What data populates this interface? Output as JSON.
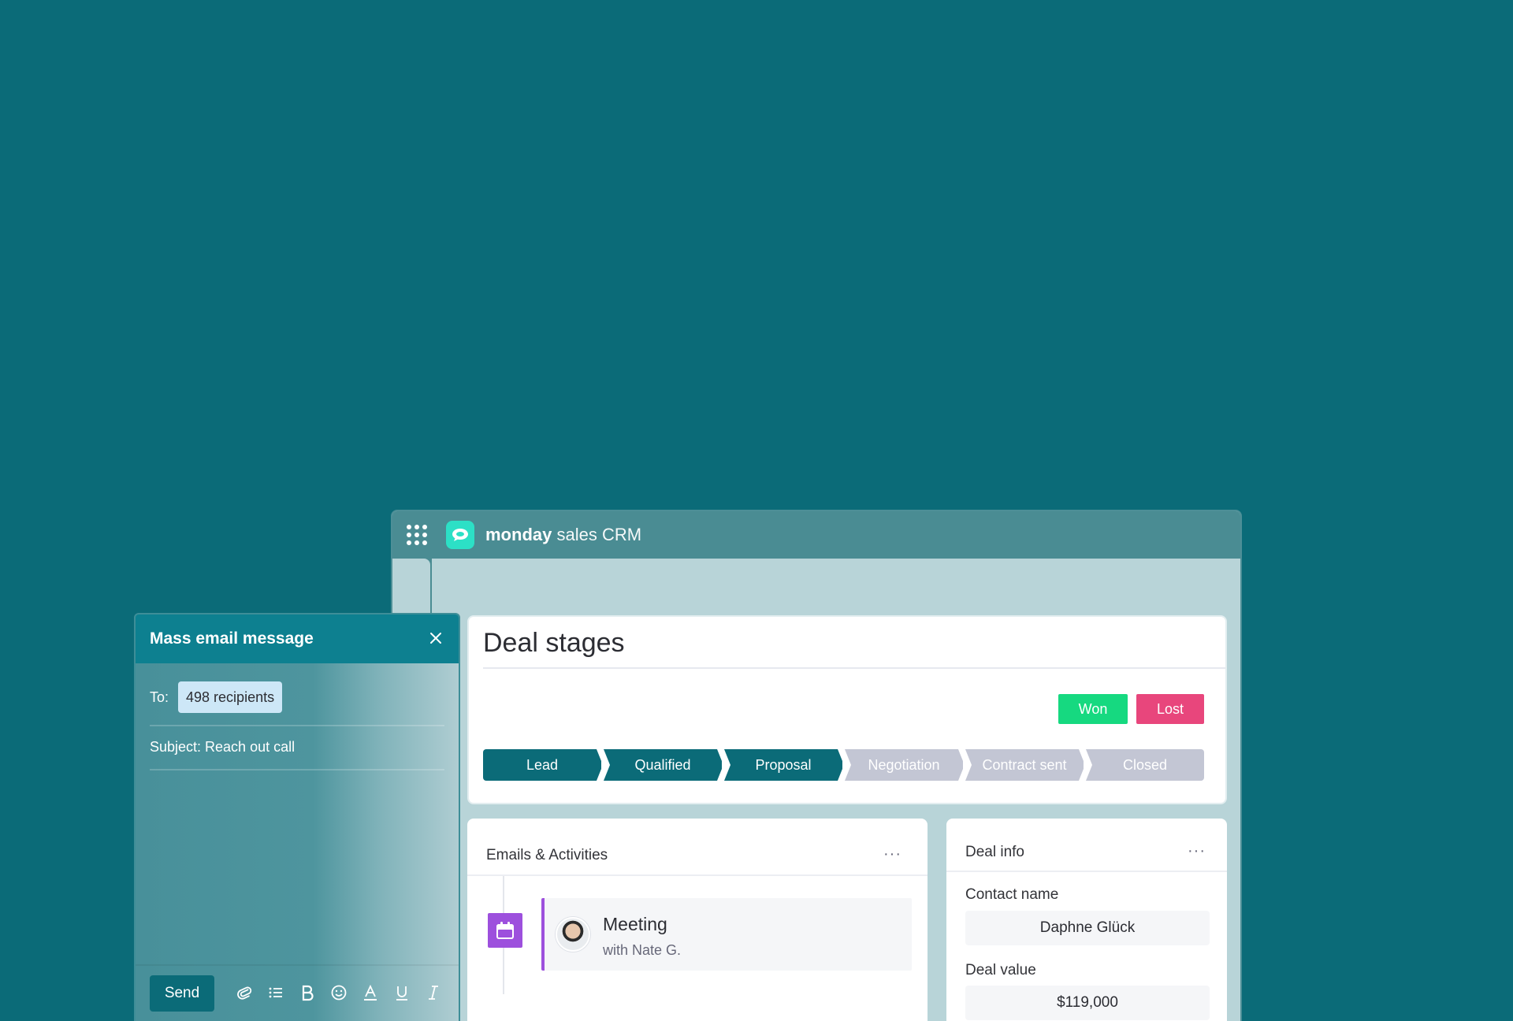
{
  "app": {
    "brand_bold": "monday",
    "brand_light": " sales CRM"
  },
  "deal_stages": {
    "title": "Deal stages",
    "won_label": "Won",
    "lost_label": "Lost",
    "stages": [
      {
        "label": "Lead",
        "state": "done"
      },
      {
        "label": "Qualified",
        "state": "done"
      },
      {
        "label": "Proposal",
        "state": "done"
      },
      {
        "label": "Negotiation",
        "state": "todo"
      },
      {
        "label": "Contract sent",
        "state": "todo"
      },
      {
        "label": "Closed",
        "state": "todo"
      }
    ]
  },
  "activities": {
    "title": "Emails & Activities",
    "more": "···",
    "items": [
      {
        "title": "Meeting",
        "subtitle": "with Nate G.",
        "icon": "calendar-icon"
      }
    ]
  },
  "deal_info": {
    "title": "Deal info",
    "more": "···",
    "contact_label": "Contact name",
    "contact_value": "Daphne Glück",
    "value_label": "Deal value",
    "value_value": "$119,000"
  },
  "email": {
    "title": "Mass email message",
    "to_label": "To:",
    "recipients": "498 recipients",
    "subject": "Subject: Reach out call",
    "send_label": "Send",
    "tools": [
      "paperclip-icon",
      "list-icon",
      "bold-icon",
      "emoji-icon",
      "text-color-icon",
      "underline-icon",
      "italic-icon"
    ]
  },
  "colors": {
    "background": "#0b6b78",
    "primary": "#0b6b78",
    "won": "#16d980",
    "lost": "#e8467c",
    "stage_inactive": "#c3c6d4",
    "activity_accent": "#9d50dd",
    "logo": "#2ce0c6"
  }
}
